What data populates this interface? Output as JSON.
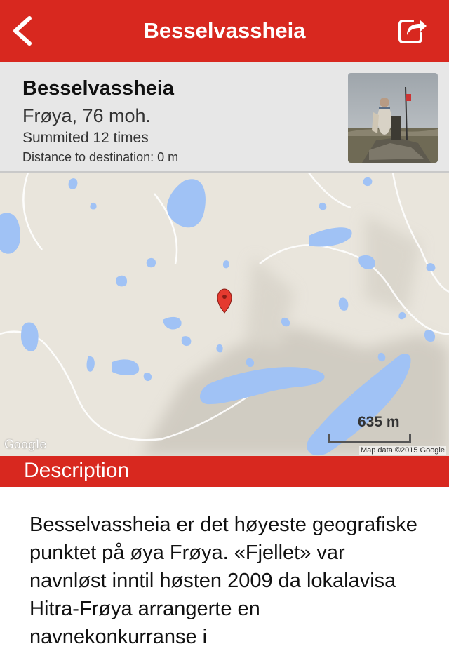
{
  "nav": {
    "title": "Besselvassheia",
    "back_icon": "chevron-left-icon",
    "share_icon": "share-icon",
    "color": "#d8281f"
  },
  "info": {
    "name": "Besselvassheia",
    "place": "Frøya, 76 moh.",
    "summits": "Summited 12 times",
    "distance": "Distance to destination: 0 m"
  },
  "map": {
    "scale": "635 m",
    "logo": "Google",
    "attribution": "Map data ©2015 Google",
    "marker_icon": "map-pin-icon"
  },
  "description": {
    "header": "Description",
    "text": "Besselvassheia er det høyeste geografiske punktet på øya Frøya. «Fjellet» var navnløst inntil høsten 2009 da lokalavisa Hitra-Frøya arrangerte en navnekonkurranse i"
  }
}
